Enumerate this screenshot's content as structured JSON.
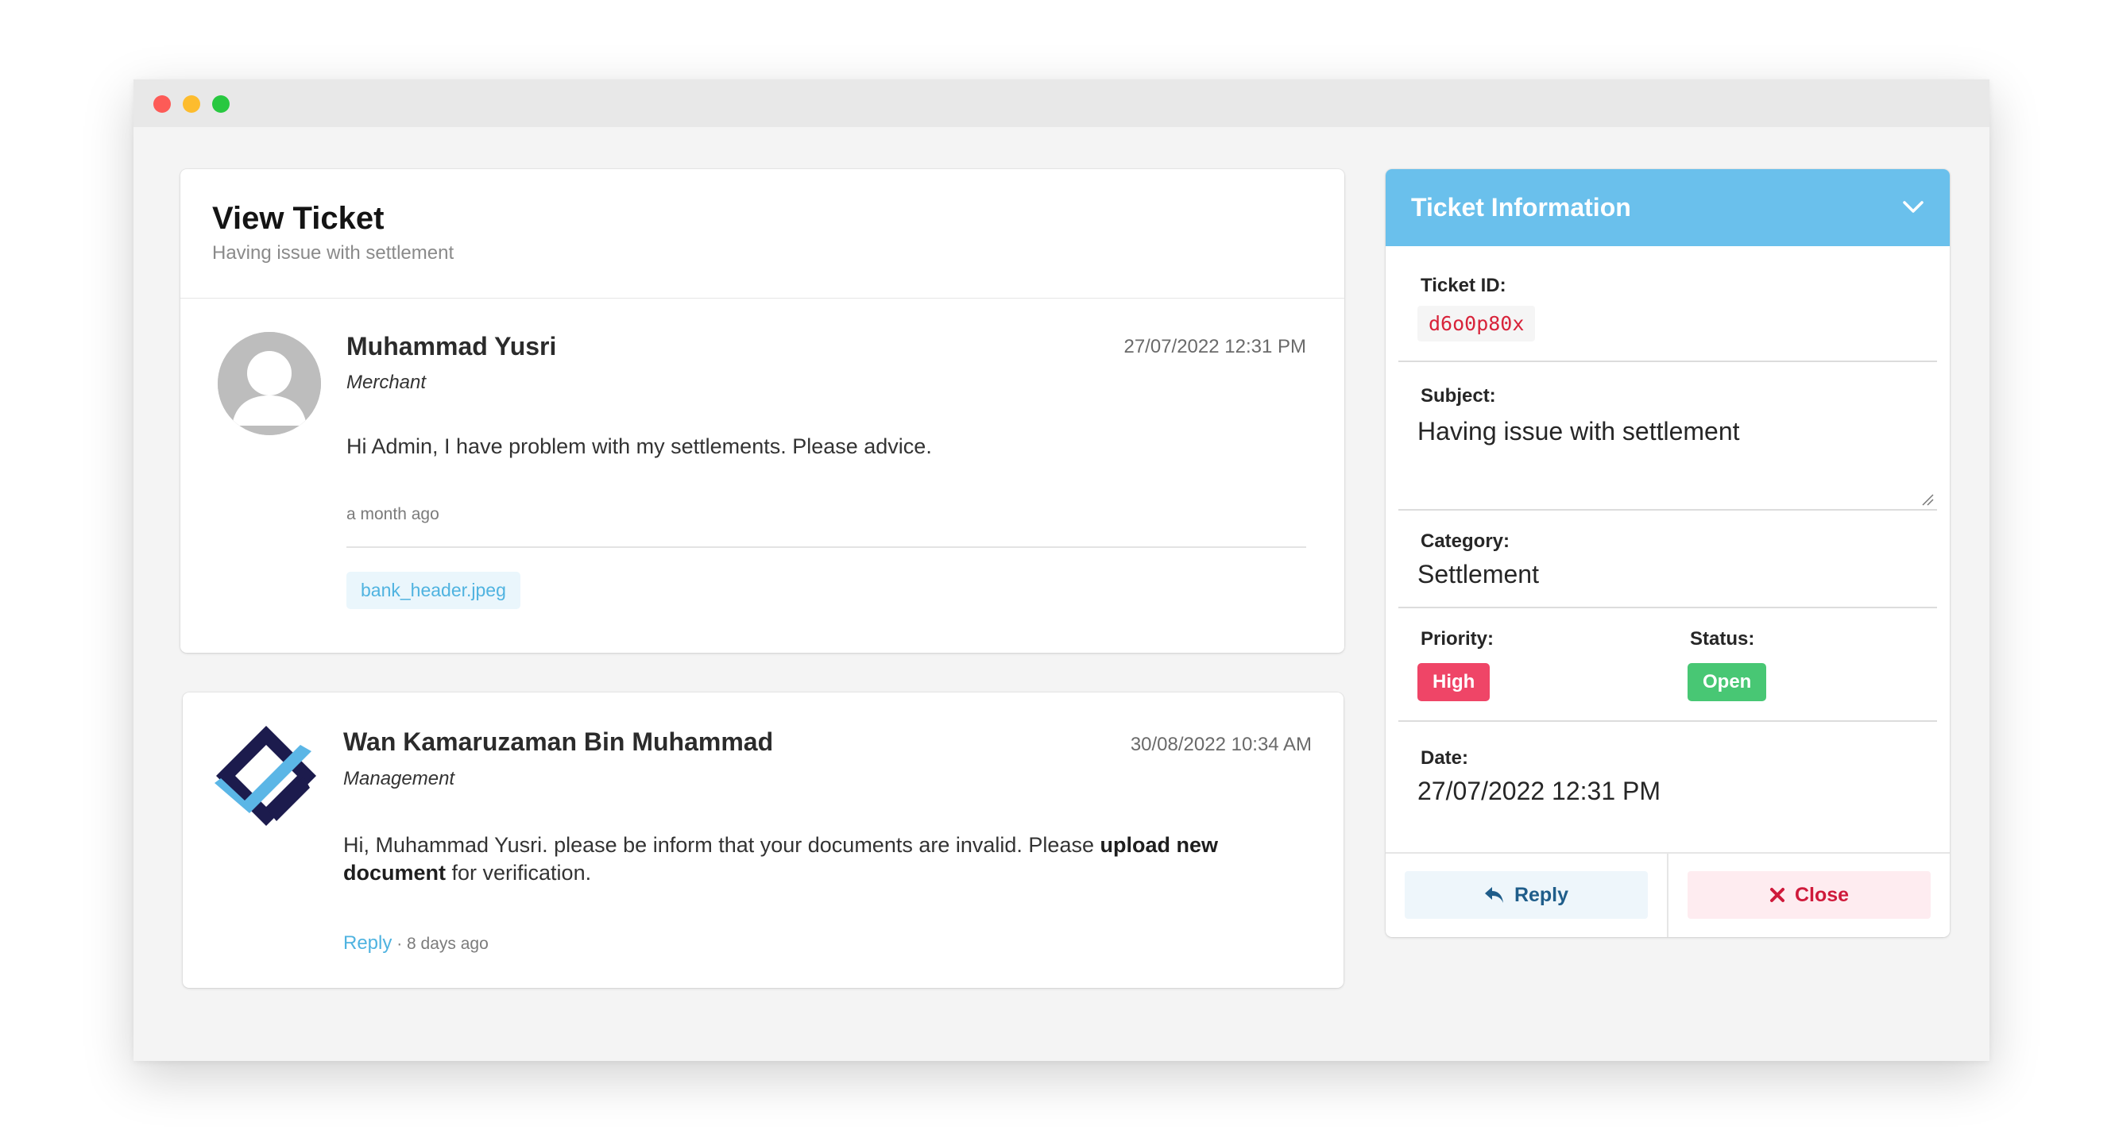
{
  "main": {
    "title": "View Ticket",
    "subtitle": "Having issue with settlement"
  },
  "messages": [
    {
      "author": "Muhammad Yusri",
      "role": "Merchant",
      "date": "27/07/2022 12:31 PM",
      "text": "Hi Admin, I have problem with my settlements. Please advice.",
      "relative_time": "a month ago",
      "attachment": "bank_header.jpeg"
    },
    {
      "author": "Wan Kamaruzaman Bin Muhammad",
      "role": "Management",
      "date": "30/08/2022 10:34 AM",
      "text_part1": "Hi, Muhammad Yusri. please be inform that your documents are invalid. Please ",
      "text_bold": "upload new document",
      "text_part2": " for verification.",
      "reply_label": "Reply",
      "separator": "·",
      "relative_time": "8 days ago"
    }
  ],
  "info": {
    "title": "Ticket Information",
    "ticket_id_label": "Ticket ID:",
    "ticket_id": "d6o0p80x",
    "subject_label": "Subject:",
    "subject": "Having issue with settlement",
    "category_label": "Category:",
    "category": "Settlement",
    "priority_label": "Priority:",
    "priority": "High",
    "status_label": "Status:",
    "status": "Open",
    "date_label": "Date:",
    "date": "27/07/2022 12:31 PM",
    "reply_button": "Reply",
    "close_button": "Close"
  },
  "colors": {
    "accent": "#6ac0ec",
    "priority_high": "#ef4567",
    "status_open": "#48c774",
    "link": "#4fb3e0"
  },
  "icons": {
    "window_controls": [
      "close-dot",
      "minimize-dot",
      "maximize-dot"
    ],
    "avatar": "user-avatar-icon",
    "logo": "company-logo-icon",
    "chevron": "chevron-down-icon",
    "reply": "reply-arrow-icon",
    "close": "x-icon"
  }
}
